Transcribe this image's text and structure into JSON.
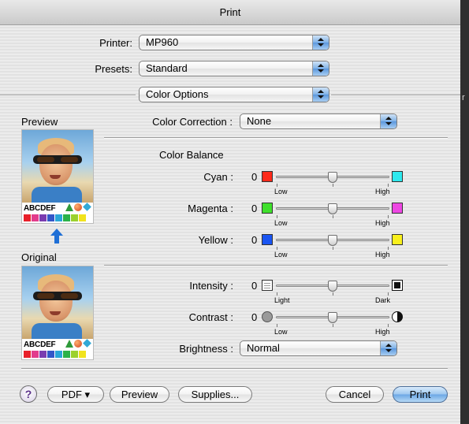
{
  "window": {
    "title": "Print"
  },
  "printer": {
    "label": "Printer:",
    "value": "MP960"
  },
  "presets": {
    "label": "Presets:",
    "value": "Standard"
  },
  "panel": {
    "value": "Color Options"
  },
  "preview": {
    "label": "Preview",
    "sample_text": "ABCDEF"
  },
  "original": {
    "label": "Original",
    "sample_text": "ABCDEF"
  },
  "swatch_colors": [
    "#e8202a",
    "#e23c8c",
    "#7a3bb0",
    "#3357c8",
    "#2aa6d8",
    "#2bb24a",
    "#9bd12d",
    "#f1e31d"
  ],
  "color_correction": {
    "label": "Color Correction :",
    "value": "None"
  },
  "color_balance": {
    "heading": "Color Balance",
    "sliders": [
      {
        "label": "Cyan :",
        "value": "0",
        "low": "Low",
        "high": "High",
        "low_color": "#ff2a1a",
        "high_color": "#2ee9ee"
      },
      {
        "label": "Magenta :",
        "value": "0",
        "low": "Low",
        "high": "High",
        "low_color": "#3fe02c",
        "high_color": "#ee47e3"
      },
      {
        "label": "Yellow :",
        "value": "0",
        "low": "Low",
        "high": "High",
        "low_color": "#1a55f2",
        "high_color": "#f9f01d"
      }
    ]
  },
  "intensity": {
    "label": "Intensity :",
    "value": "0",
    "low": "Light",
    "high": "Dark",
    "low_icon": "light-icon",
    "high_icon": "dark-icon"
  },
  "contrast": {
    "label": "Contrast :",
    "value": "0",
    "low": "Low",
    "high": "High",
    "low_icon": "contrast-low-icon",
    "high_icon": "contrast-high-icon"
  },
  "brightness": {
    "label": "Brightness :",
    "value": "Normal"
  },
  "buttons": {
    "help": "?",
    "pdf": "PDF ▾",
    "preview": "Preview",
    "supplies": "Supplies...",
    "cancel": "Cancel",
    "print": "Print"
  }
}
